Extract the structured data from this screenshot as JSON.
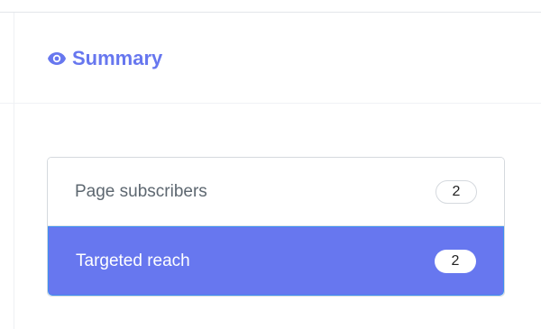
{
  "summary": {
    "title": "Summary",
    "icon": "eye-icon",
    "accent_color": "#6777ef"
  },
  "list": [
    {
      "label": "Page subscribers",
      "count": "2",
      "active": false
    },
    {
      "label": "Targeted reach",
      "count": "2",
      "active": true
    }
  ]
}
